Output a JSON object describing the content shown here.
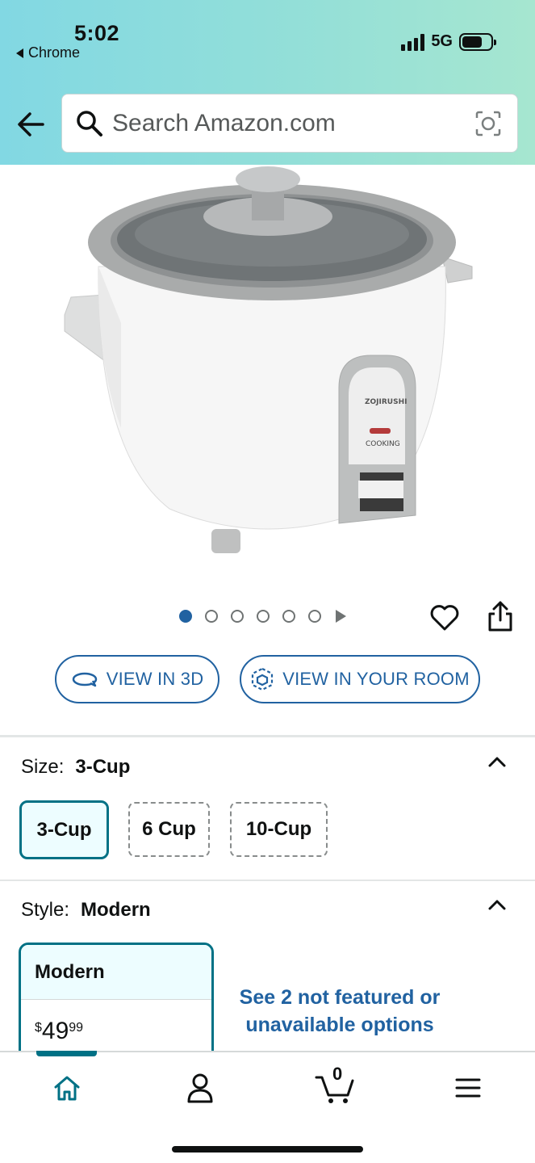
{
  "status_bar": {
    "time": "5:02",
    "back_app": "Chrome",
    "network": "5G"
  },
  "search": {
    "placeholder": "Search Amazon.com"
  },
  "gallery": {
    "total_dots": 6,
    "active_index": 0
  },
  "actions": {
    "view_3d": "VIEW IN 3D",
    "view_room": "VIEW IN YOUR ROOM"
  },
  "size": {
    "label": "Size:",
    "selected": "3-Cup",
    "options": [
      "3-Cup",
      "6 Cup",
      "10-Cup"
    ]
  },
  "style": {
    "label": "Style:",
    "selected": "Modern",
    "card_title": "Modern",
    "price_symbol": "$",
    "price_whole": "49",
    "price_fraction": "99",
    "see_more": "See 2 not featured or unavailable options"
  },
  "cart": {
    "count": "0"
  },
  "colors": {
    "accent_teal": "#007185",
    "link_blue": "#2162a1",
    "selected_bg": "#edfdff"
  }
}
